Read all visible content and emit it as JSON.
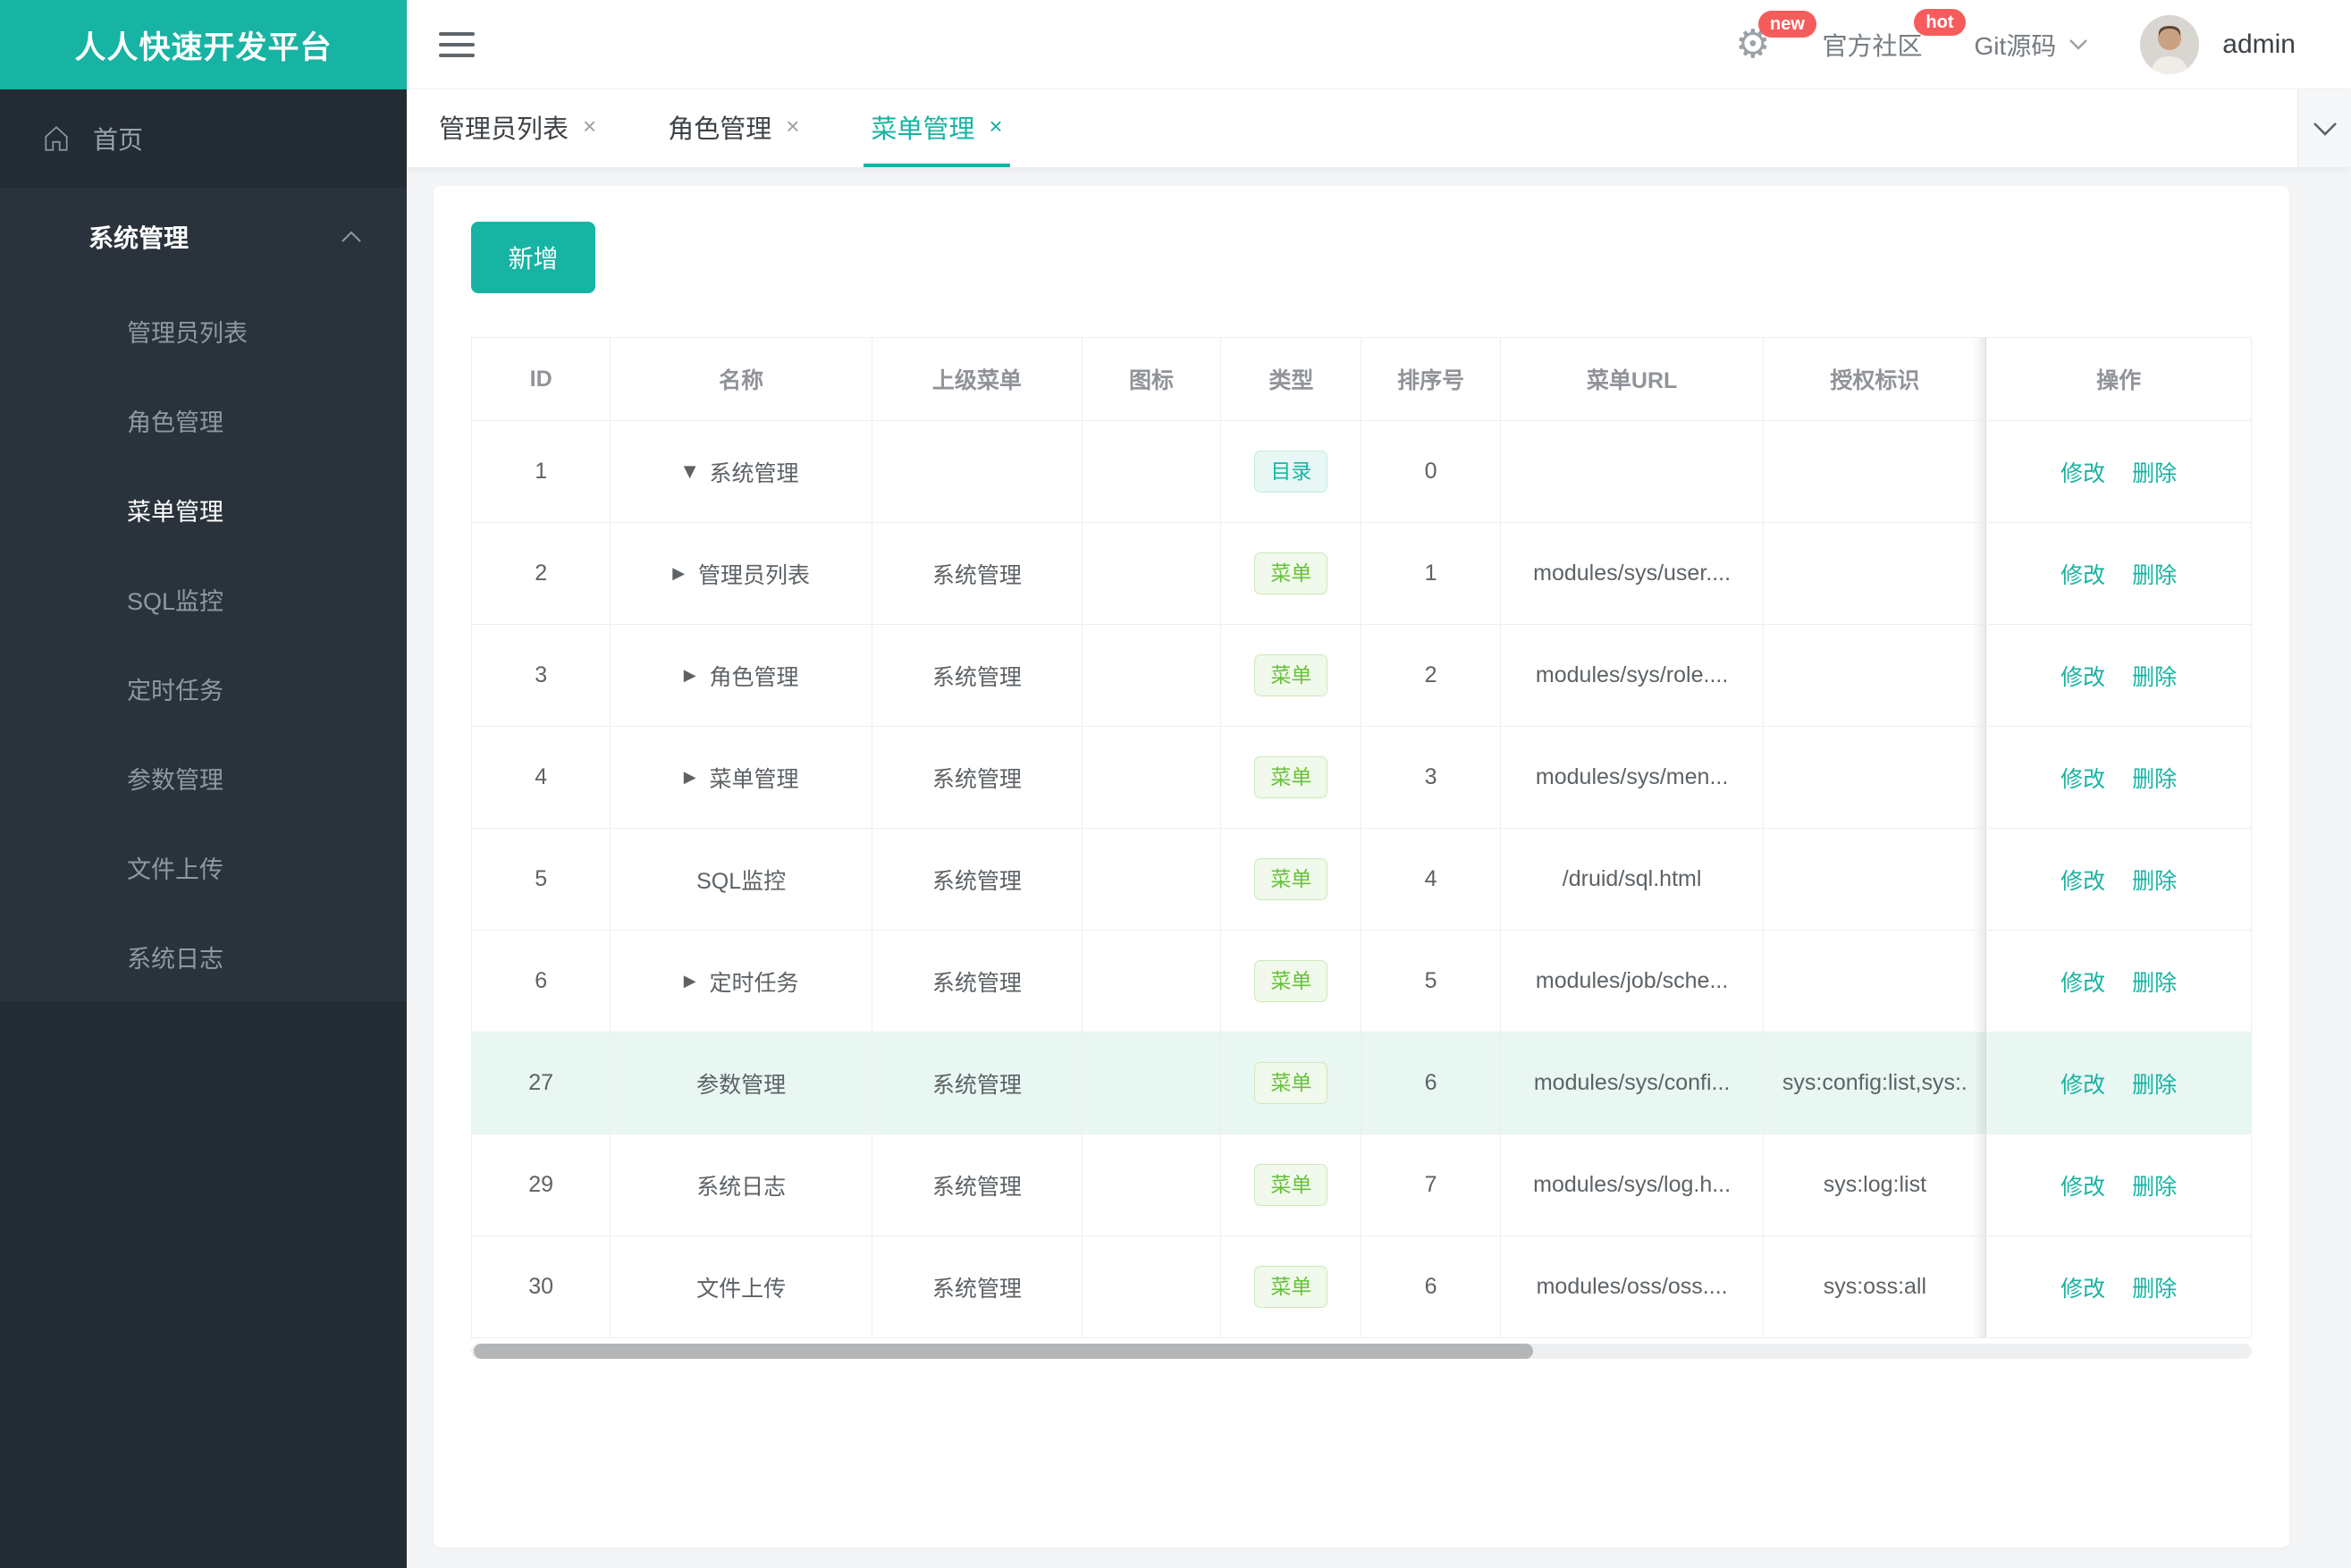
{
  "app": {
    "logo": "人人快速开发平台"
  },
  "topbar": {
    "gear_badge": "new",
    "community": "官方社区",
    "community_badge": "hot",
    "git": "Git源码",
    "username": "admin"
  },
  "tabs": {
    "items": [
      {
        "label": "管理员列表",
        "close": "×"
      },
      {
        "label": "角色管理",
        "close": "×"
      },
      {
        "label": "菜单管理",
        "close": "×"
      }
    ]
  },
  "sidebar": {
    "home": "首页",
    "group": "系统管理",
    "items": [
      {
        "label": "管理员列表"
      },
      {
        "label": "角色管理"
      },
      {
        "label": "菜单管理"
      },
      {
        "label": "SQL监控"
      },
      {
        "label": "定时任务"
      },
      {
        "label": "参数管理"
      },
      {
        "label": "文件上传"
      },
      {
        "label": "系统日志"
      }
    ]
  },
  "toolbar": {
    "add_label": "新增"
  },
  "table": {
    "columns": [
      "ID",
      "名称",
      "上级菜单",
      "图标",
      "类型",
      "排序号",
      "菜单URL",
      "授权标识",
      "操作"
    ],
    "edit_label": "修改",
    "delete_label": "删除",
    "rows": [
      {
        "id": "1",
        "arrow": "▼",
        "name": "系统管理",
        "parent": "",
        "type": "目录",
        "order": "0",
        "url": "",
        "perms": ""
      },
      {
        "id": "2",
        "arrow": "▶",
        "name": "管理员列表",
        "parent": "系统管理",
        "type": "菜单",
        "order": "1",
        "url": "modules/sys/user....",
        "perms": ""
      },
      {
        "id": "3",
        "arrow": "▶",
        "name": "角色管理",
        "parent": "系统管理",
        "type": "菜单",
        "order": "2",
        "url": "modules/sys/role....",
        "perms": ""
      },
      {
        "id": "4",
        "arrow": "▶",
        "name": "菜单管理",
        "parent": "系统管理",
        "type": "菜单",
        "order": "3",
        "url": "modules/sys/men...",
        "perms": ""
      },
      {
        "id": "5",
        "arrow": "",
        "name": "SQL监控",
        "parent": "系统管理",
        "type": "菜单",
        "order": "4",
        "url": "/druid/sql.html",
        "perms": ""
      },
      {
        "id": "6",
        "arrow": "▶",
        "name": "定时任务",
        "parent": "系统管理",
        "type": "菜单",
        "order": "5",
        "url": "modules/job/sche...",
        "perms": ""
      },
      {
        "id": "27",
        "arrow": "",
        "name": "参数管理",
        "parent": "系统管理",
        "type": "菜单",
        "order": "6",
        "url": "modules/sys/confi...",
        "perms": "sys:config:list,sys:."
      },
      {
        "id": "29",
        "arrow": "",
        "name": "系统日志",
        "parent": "系统管理",
        "type": "菜单",
        "order": "7",
        "url": "modules/sys/log.h...",
        "perms": "sys:log:list"
      },
      {
        "id": "30",
        "arrow": "",
        "name": "文件上传",
        "parent": "系统管理",
        "type": "菜单",
        "order": "6",
        "url": "modules/oss/oss....",
        "perms": "sys:oss:all"
      }
    ]
  },
  "colors": {
    "primary": "#17b3a3",
    "badge_red": "#f75c5c",
    "catalog_teal": "#19b5a3",
    "menu_green": "#67c23a",
    "row_highlight": "#e9f7f3"
  }
}
